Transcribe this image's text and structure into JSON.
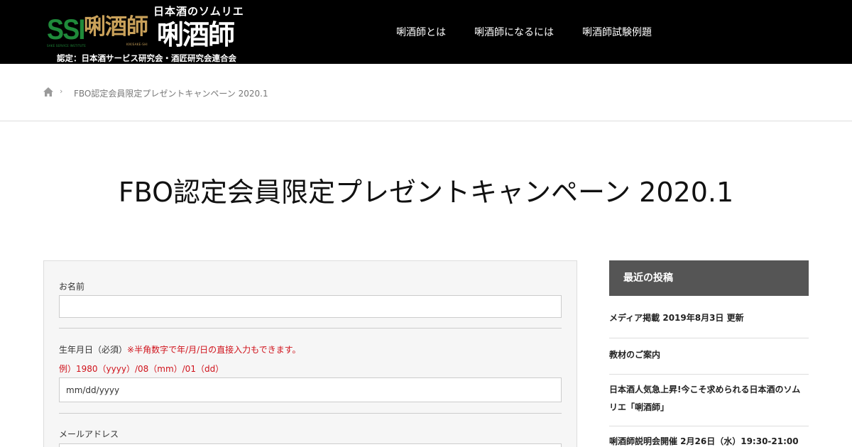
{
  "header": {
    "logo": {
      "ssi": "SSI",
      "ssi_sub": "SAKE SERVICE INSTITUTE",
      "brand_gold": "唎酒師",
      "brand_gold_sub": "KIKISAKE-SHI",
      "tagline": "日本酒のソムリエ",
      "brand_white": "唎酒師",
      "cert": "認定：日本酒サービス研究会・酒匠研究会連合会"
    },
    "nav": [
      {
        "label": "唎酒師とは"
      },
      {
        "label": "唎酒師になるには"
      },
      {
        "label": "唎酒師試験例題"
      }
    ]
  },
  "breadcrumb": {
    "home_icon": "home-icon",
    "separator": "›",
    "current": "FBO認定会員限定プレゼントキャンペーン 2020.1"
  },
  "page": {
    "title": "FBO認定会員限定プレゼントキャンペーン 2020.1"
  },
  "form": {
    "name_label": "お名前",
    "name_value": "",
    "birth_label": "生年月日（必須）",
    "birth_note": "※半角数字で年/月/日の直接入力もできます。",
    "birth_example": "例）1980（yyyy）/08（mm）/01（dd）",
    "birth_placeholder": "mm/dd/yyyy",
    "email_label": "メールアドレス"
  },
  "sidebar": {
    "heading": "最近の投稿",
    "posts": [
      {
        "title": "メディア掲載 2019年8月3日 更新"
      },
      {
        "title": "教材のご案内"
      },
      {
        "title": "日本酒人気急上昇!今こそ求められる日本酒のソムリエ「唎酒師」"
      },
      {
        "title": "唎酒師説明会開催 2月26日（水）19:30-21:00"
      }
    ]
  },
  "colors": {
    "header_bg": "#000000",
    "ssi_green": "#1f8a3a",
    "brand_gold": "#c9a15a",
    "required_red": "#d0121b",
    "sidebar_head_bg": "#555555"
  }
}
